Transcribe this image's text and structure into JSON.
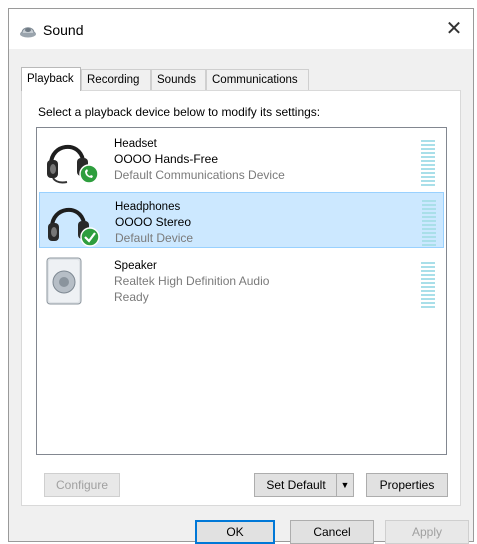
{
  "window": {
    "title": "Sound",
    "close_glyph": "✕"
  },
  "tabs": [
    {
      "label": "Playback",
      "active": true
    },
    {
      "label": "Recording",
      "active": false
    },
    {
      "label": "Sounds",
      "active": false
    },
    {
      "label": "Communications",
      "active": false
    }
  ],
  "instruction": "Select a playback device below to modify its settings:",
  "devices": [
    {
      "name": "Headset",
      "description": "OOOO Hands-Free",
      "status": "Default Communications Device",
      "icon": "headset-icon",
      "badge": "phone-badge-icon",
      "selected": false
    },
    {
      "name": "Headphones",
      "description": "OOOO Stereo",
      "status": "Default Device",
      "icon": "headphones-icon",
      "badge": "checkmark-badge-icon",
      "selected": true
    },
    {
      "name": "Speaker",
      "description": "Realtek High Definition Audio",
      "status": "Ready",
      "icon": "speaker-icon",
      "badge": "",
      "selected": false
    }
  ],
  "buttons": {
    "configure": "Configure",
    "set_default": "Set Default",
    "set_default_arrow": "▼",
    "properties": "Properties",
    "ok": "OK",
    "cancel": "Cancel",
    "apply": "Apply"
  },
  "colors": {
    "selection": "#cce8ff",
    "accent": "#0078d7",
    "badge_green": "#2e9e3e"
  }
}
